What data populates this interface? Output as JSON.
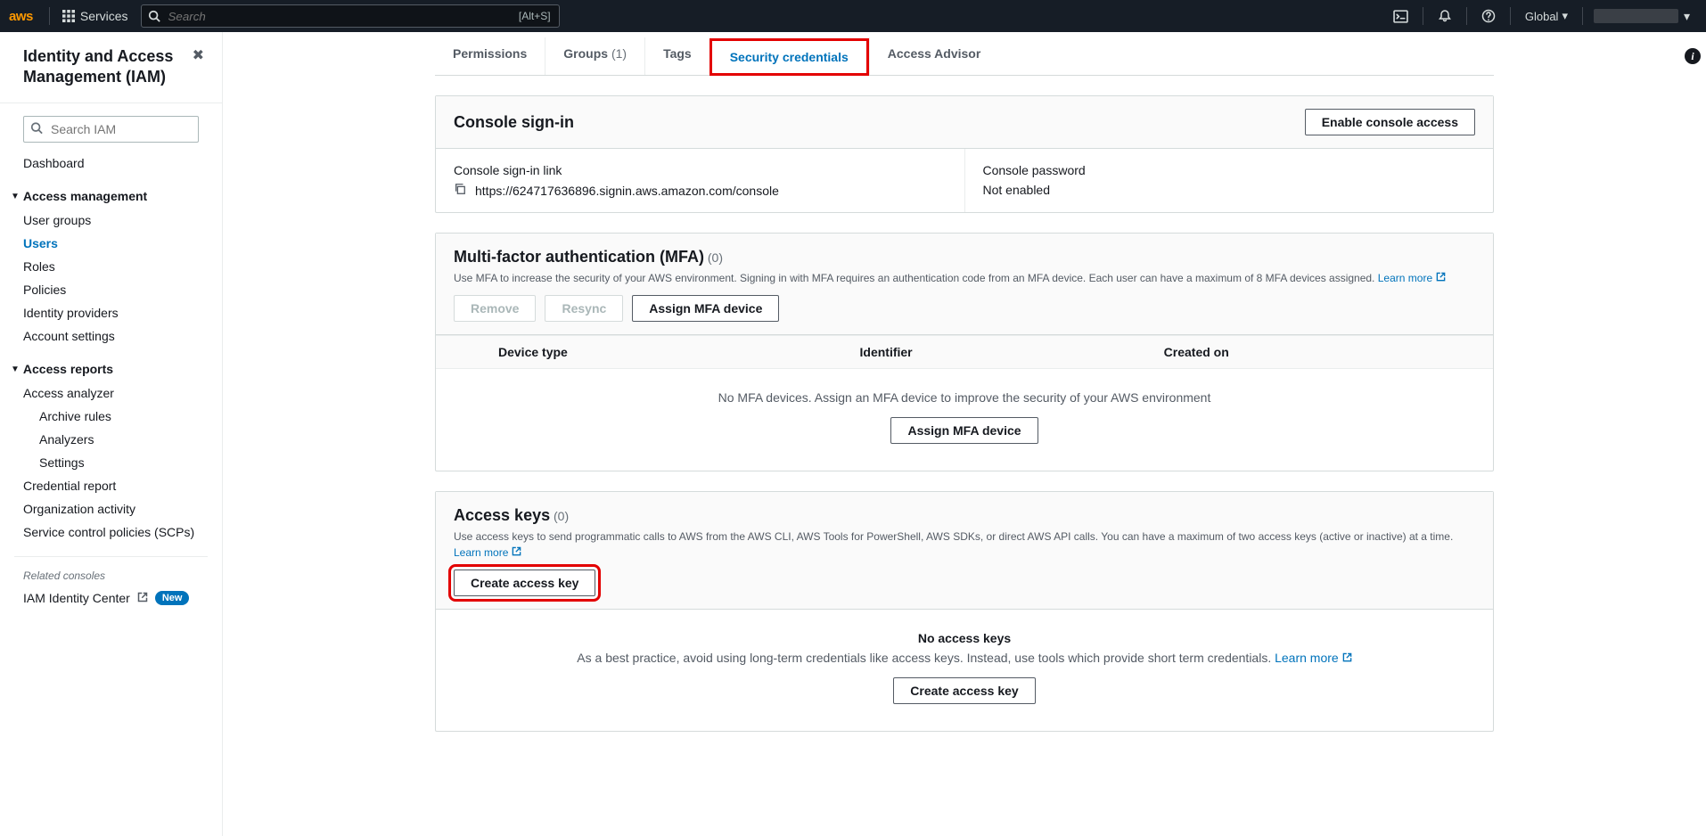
{
  "topnav": {
    "logo_text": "aws",
    "services_label": "Services",
    "search_placeholder": "Search",
    "search_shortcut": "[Alt+S]",
    "region_label": "Global"
  },
  "sidebar": {
    "title": "Identity and Access Management (IAM)",
    "search_placeholder": "Search IAM",
    "dashboard_label": "Dashboard",
    "access_mgmt_label": "Access management",
    "access_mgmt_items": [
      {
        "label": "User groups"
      },
      {
        "label": "Users",
        "active": true
      },
      {
        "label": "Roles"
      },
      {
        "label": "Policies"
      },
      {
        "label": "Identity providers"
      },
      {
        "label": "Account settings"
      }
    ],
    "reports_label": "Access reports",
    "reports_items": {
      "access_analyzer": "Access analyzer",
      "archive_rules": "Archive rules",
      "analyzers": "Analyzers",
      "settings": "Settings",
      "credential_report": "Credential report",
      "org_activity": "Organization activity",
      "scps": "Service control policies (SCPs)"
    },
    "related_label": "Related consoles",
    "identity_center": "IAM Identity Center",
    "new_badge": "New"
  },
  "tabs": {
    "permissions": "Permissions",
    "groups_label": "Groups",
    "groups_count": "(1)",
    "tags": "Tags",
    "security_credentials": "Security credentials",
    "access_advisor": "Access Advisor"
  },
  "console_signin": {
    "title": "Console sign-in",
    "enable_btn": "Enable console access",
    "link_label": "Console sign-in link",
    "link_value": "https://624717636896.signin.aws.amazon.com/console",
    "password_label": "Console password",
    "password_value": "Not enabled"
  },
  "mfa": {
    "title": "Multi-factor authentication (MFA)",
    "count": "(0)",
    "desc": "Use MFA to increase the security of your AWS environment. Signing in with MFA requires an authentication code from an MFA device. Each user can have a maximum of 8 MFA devices assigned.",
    "learn_more": "Learn more",
    "remove_btn": "Remove",
    "resync_btn": "Resync",
    "assign_btn": "Assign MFA device",
    "col_device_type": "Device type",
    "col_identifier": "Identifier",
    "col_created_on": "Created on",
    "empty_msg": "No MFA devices. Assign an MFA device to improve the security of your AWS environment",
    "empty_assign_btn": "Assign MFA device"
  },
  "access_keys": {
    "title": "Access keys",
    "count": "(0)",
    "desc": "Use access keys to send programmatic calls to AWS from the AWS CLI, AWS Tools for PowerShell, AWS SDKs, or direct AWS API calls. You can have a maximum of two access keys (active or inactive) at a time.",
    "learn_more": "Learn more",
    "create_btn": "Create access key",
    "empty_title": "No access keys",
    "empty_desc": "As a best practice, avoid using long-term credentials like access keys. Instead, use tools which provide short term credentials.",
    "empty_learn_more": "Learn more",
    "empty_create_btn": "Create access key"
  }
}
